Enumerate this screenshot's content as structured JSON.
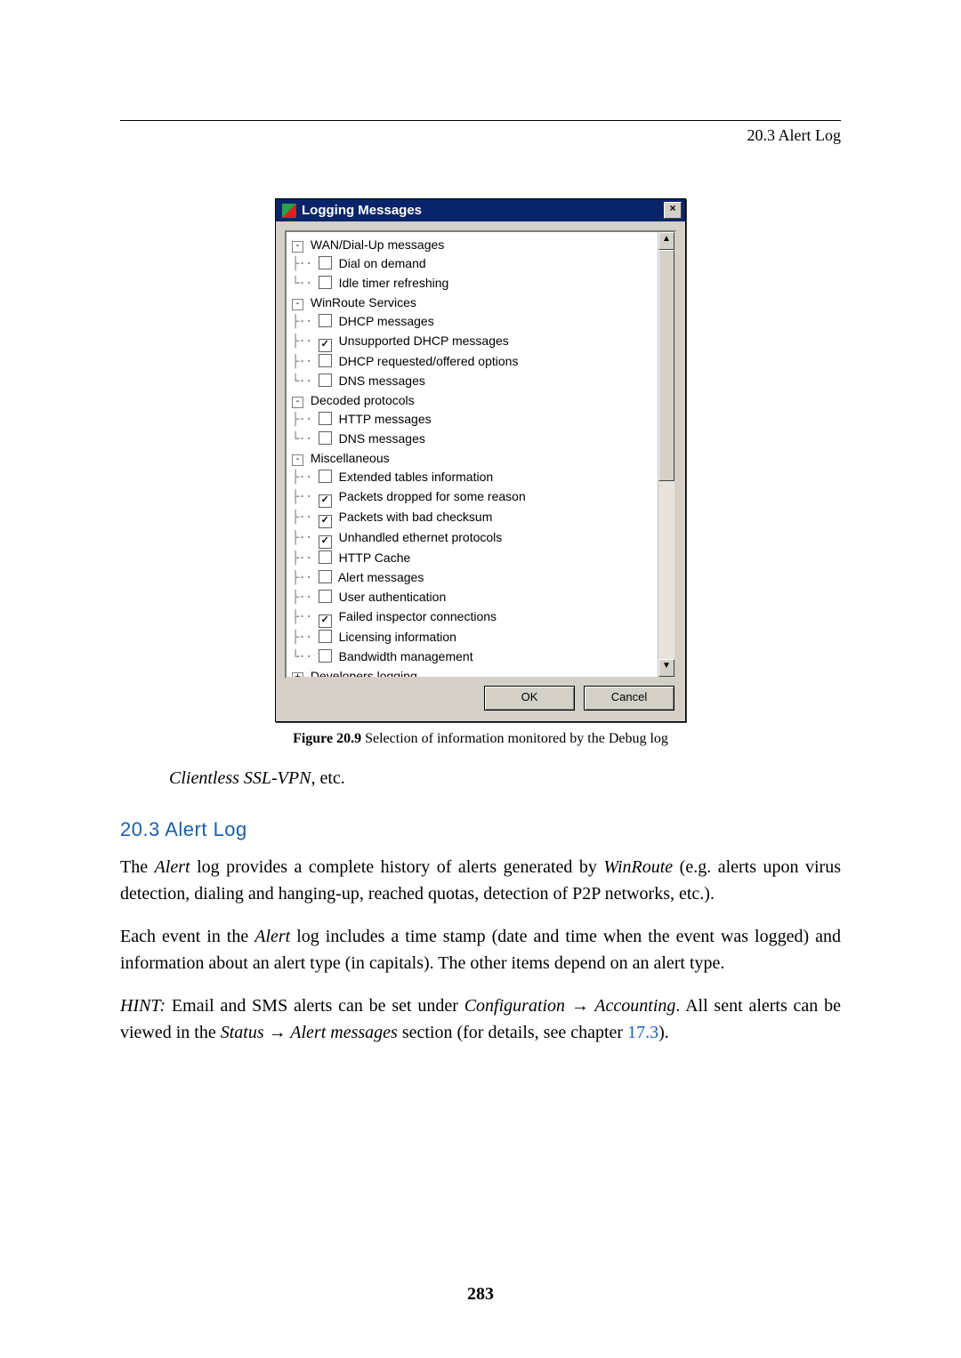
{
  "running_head": "20.3 Alert Log",
  "dialog": {
    "title": "Logging Messages",
    "close_glyph": "×",
    "ok_label": "OK",
    "cancel_label": "Cancel",
    "scroll_up": "▲",
    "scroll_down": "▼",
    "tree": {
      "groups": [
        {
          "toggle": "-",
          "label": "WAN/Dial-Up messages",
          "items": [
            {
              "checked": false,
              "label": "Dial on demand",
              "last": false
            },
            {
              "checked": false,
              "label": "Idle timer refreshing",
              "last": true
            }
          ]
        },
        {
          "toggle": "-",
          "label": "WinRoute Services",
          "items": [
            {
              "checked": false,
              "label": "DHCP messages",
              "last": false
            },
            {
              "checked": true,
              "label": "Unsupported DHCP messages",
              "last": false
            },
            {
              "checked": false,
              "label": "DHCP requested/offered options",
              "last": false
            },
            {
              "checked": false,
              "label": "DNS messages",
              "last": true
            }
          ]
        },
        {
          "toggle": "-",
          "label": "Decoded protocols",
          "items": [
            {
              "checked": false,
              "label": "HTTP messages",
              "last": false
            },
            {
              "checked": false,
              "label": "DNS messages",
              "last": true
            }
          ]
        },
        {
          "toggle": "-",
          "label": "Miscellaneous",
          "items": [
            {
              "checked": false,
              "label": "Extended tables information",
              "last": false
            },
            {
              "checked": true,
              "label": "Packets dropped for some reason",
              "last": false
            },
            {
              "checked": true,
              "label": "Packets with bad checksum",
              "last": false
            },
            {
              "checked": true,
              "label": "Unhandled ethernet protocols",
              "last": false
            },
            {
              "checked": false,
              "label": "HTTP Cache",
              "last": false
            },
            {
              "checked": false,
              "label": "Alert messages",
              "last": false
            },
            {
              "checked": false,
              "label": "User authentication",
              "last": false
            },
            {
              "checked": true,
              "label": "Failed inspector connections",
              "last": false
            },
            {
              "checked": false,
              "label": "Licensing information",
              "last": false
            },
            {
              "checked": false,
              "label": "Bandwidth management",
              "last": true
            }
          ]
        },
        {
          "toggle": "+",
          "label": "Developers logging",
          "items": []
        }
      ]
    }
  },
  "caption": {
    "num": "Figure 20.9",
    "text": " Selection of information monitored by the Debug log"
  },
  "clientless_line_prefix": "Clientless SSL-VPN",
  "clientless_line_suffix": ", etc.",
  "section_heading": "20.3 Alert Log",
  "para1_a": "The ",
  "para1_b": "Alert",
  "para1_c": " log provides a complete history of alerts generated by ",
  "para1_d": "WinRoute",
  "para1_e": " (e.g. alerts upon virus detection, dialing and hanging-up, reached quotas, detection of P2P networks, etc.).",
  "para2_a": "Each event in the ",
  "para2_b": "Alert",
  "para2_c": " log includes a time stamp (date and time when the event was logged) and information about an alert type (in capitals). The other items depend on an alert type.",
  "para3_a": "HINT:",
  "para3_b": " Email and SMS alerts can be set under ",
  "para3_c": "Configuration → Accounting",
  "para3_d": ". All sent alerts can be viewed in the ",
  "para3_e": "Status → Alert messages",
  "para3_f": " section (for details, see chapter ",
  "para3_g": "17.3",
  "para3_h": ").",
  "page_number": "283"
}
